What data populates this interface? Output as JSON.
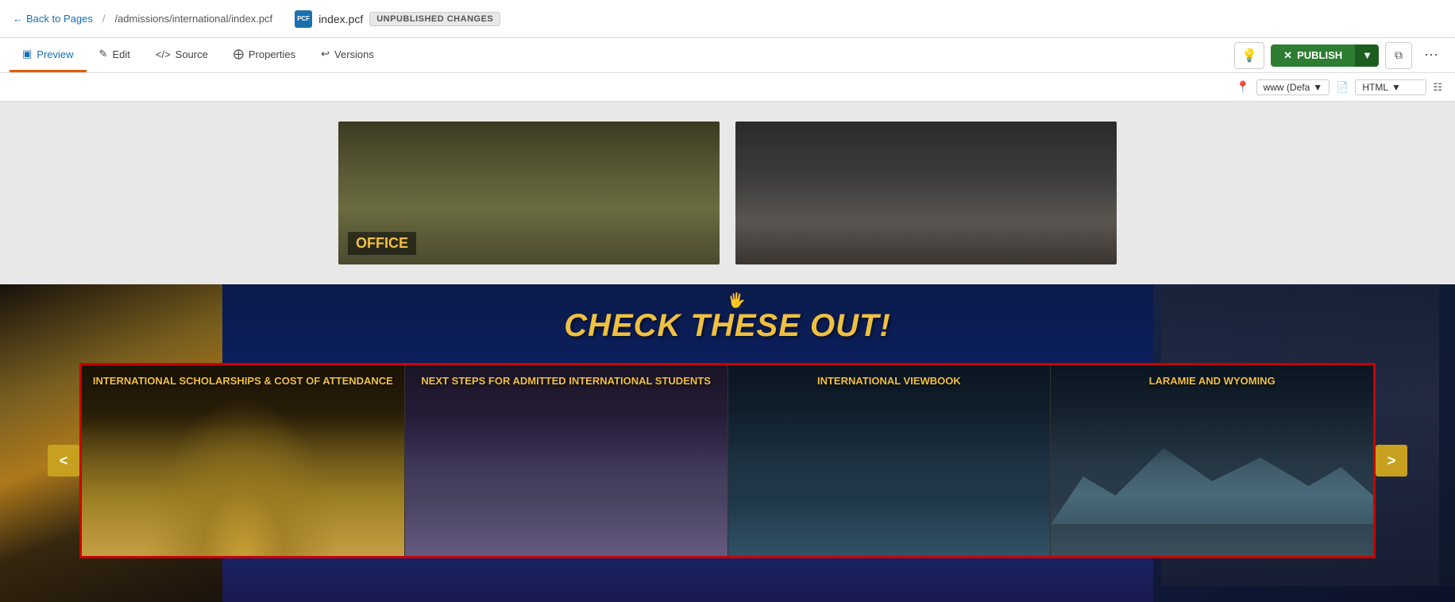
{
  "topbar": {
    "back_label": "Back to Pages",
    "breadcrumb_path": "/admissions/international/index.pcf",
    "file_icon_text": "PCF",
    "file_name": "index.pcf",
    "unpublished_label": "UNPUBLISHED CHANGES"
  },
  "navbar": {
    "tabs": [
      {
        "id": "preview",
        "label": "Preview",
        "icon": "⊞",
        "active": true
      },
      {
        "id": "edit",
        "label": "Edit",
        "icon": "✎",
        "active": false
      },
      {
        "id": "source",
        "label": "Source",
        "icon": "</>",
        "active": false
      },
      {
        "id": "properties",
        "label": "Properties",
        "icon": "⊕",
        "active": false
      },
      {
        "id": "versions",
        "label": "Versions",
        "icon": "↩",
        "active": false
      }
    ],
    "publish_label": "PUBLISH",
    "publish_icon": "✕",
    "location_dropdown": "www (Defa",
    "format_dropdown": "HTML"
  },
  "upper_cards": [
    {
      "id": "card1",
      "label": "OFFICE",
      "bg": "left"
    },
    {
      "id": "card2",
      "label": "",
      "bg": "right"
    }
  ],
  "cto_section": {
    "title": "CHECK THESE OUT!",
    "carousel": {
      "prev_label": "<",
      "next_label": ">",
      "cards": [
        {
          "id": "card-scholarships",
          "title": "INTERNATIONAL SCHOLARSHIPS & COST OF ATTENDANCE",
          "bg_type": "1"
        },
        {
          "id": "card-nextsteps",
          "title": "NEXT STEPS FOR ADMITTED INTERNATIONAL STUDENTS",
          "bg_type": "2"
        },
        {
          "id": "card-viewbook",
          "title": "INTERNATIONAL VIEWBOOK",
          "bg_type": "3"
        },
        {
          "id": "card-laramie",
          "title": "LARAMIE AND WYOMING",
          "bg_type": "4"
        }
      ]
    }
  },
  "colors": {
    "active_tab_underline": "#e05c00",
    "publish_green": "#2e7d32",
    "card_title_gold": "#f0c040",
    "carousel_btn_gold": "#c8a020",
    "cto_title_gold": "#f0c040",
    "red_border": "#cc0000",
    "nav_blue": "#1a6faf"
  }
}
